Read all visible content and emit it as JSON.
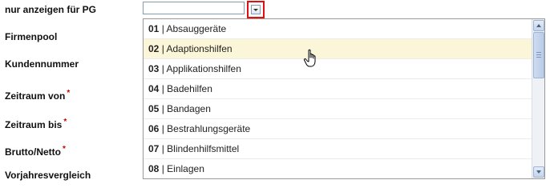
{
  "form": {
    "labels": [
      {
        "text": "nur anzeigen für PG",
        "required": false
      },
      {
        "text": "Firmenpool",
        "required": false
      },
      {
        "text": "Kundennummer",
        "required": false
      },
      {
        "text": "Zeitraum von",
        "required": true
      },
      {
        "text": "Zeitraum bis",
        "required": true
      },
      {
        "text": "Brutto/Netto",
        "required": true
      },
      {
        "text": "Vorjahresvergleich",
        "required": false
      }
    ],
    "required_marker": "*"
  },
  "combo": {
    "value": "",
    "trigger_icon": "chevron-down-icon",
    "highlight_color": "#e01010"
  },
  "dropdown": {
    "hovered_index": 1,
    "items": [
      {
        "code": "01",
        "label": "Absauggeräte"
      },
      {
        "code": "02",
        "label": "Adaptionshilfen"
      },
      {
        "code": "03",
        "label": "Applikationshilfen"
      },
      {
        "code": "04",
        "label": "Badehilfen"
      },
      {
        "code": "05",
        "label": "Bandagen"
      },
      {
        "code": "06",
        "label": "Bestrahlungsgeräte"
      },
      {
        "code": "07",
        "label": "Blindenhilfsmittel"
      },
      {
        "code": "08",
        "label": "Einlagen"
      }
    ],
    "separator": " | ",
    "hover_color": "#fcf6d9"
  }
}
